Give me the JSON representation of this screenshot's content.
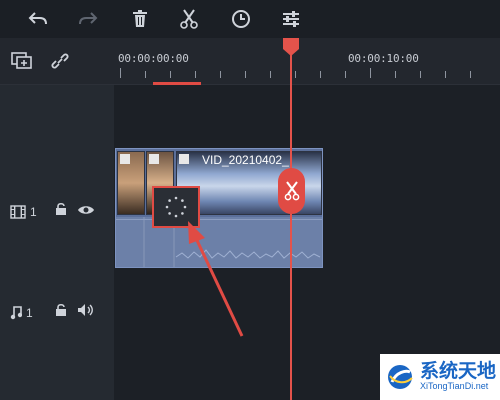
{
  "toolbar": {
    "icons": [
      "undo-icon",
      "redo-icon",
      "delete-icon",
      "scissors-icon",
      "clock-icon",
      "adjust-icon"
    ]
  },
  "ruler": {
    "start_label": "00:00:00:00",
    "mark_label": "00:00:10:00"
  },
  "video_track": {
    "number": "1",
    "clip_title": "VID_20210402_"
  },
  "audio_track": {
    "number": "1"
  },
  "watermark": {
    "main": "系统天地",
    "sub": "XiTongTianDi.net"
  },
  "colors": {
    "accent": "#e04b44",
    "clip": "#5b6f9a",
    "background": "#1f232a"
  }
}
